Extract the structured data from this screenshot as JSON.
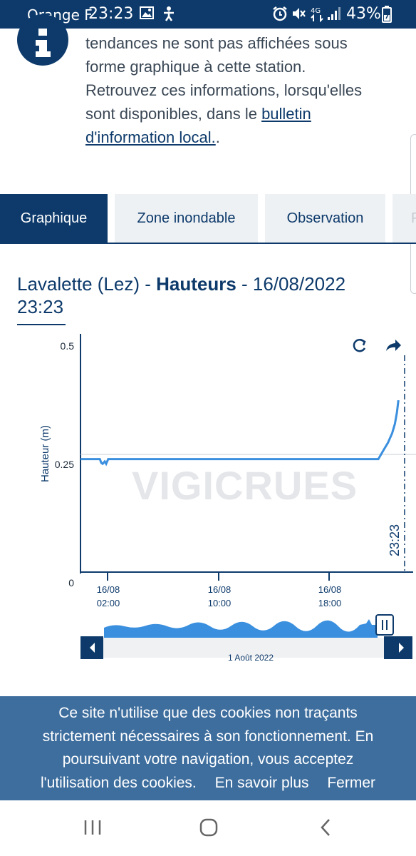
{
  "status_bar": {
    "carrier": "Orange F",
    "time": "23:23",
    "network": "4G",
    "battery": "43%",
    "icons": [
      "image-icon",
      "accessibility-icon",
      "alarm-icon",
      "mute-icon",
      "data-arrows-icon",
      "signal-icon",
      "battery-icon"
    ]
  },
  "info": {
    "icon": "info-icon",
    "lines": [
      "tendances ne sont pas affichées sous",
      "forme graphique à cette station.",
      "Retrouvez ces informations, lorsqu'elles",
      "sont disponibles, dans le"
    ],
    "link_part1": "bulletin",
    "link_part2": "d'information local.",
    "trailing": "."
  },
  "tabs": [
    {
      "label": "Graphique",
      "active": true
    },
    {
      "label": "Zone inondable",
      "active": false
    },
    {
      "label": "Observation",
      "active": false
    },
    {
      "label": "P",
      "active": false
    }
  ],
  "chart_title": {
    "station": "Lavalette (Lez) - ",
    "measure": "Hauteurs",
    "datetime_line1": " - 16/08/2022",
    "datetime_line2": "23:23"
  },
  "chart_data": {
    "type": "line",
    "ylabel": "Hauteur (m)",
    "y_ticks": [
      "0.5",
      "0.25",
      "0"
    ],
    "ylim": [
      0,
      0.5
    ],
    "x_ticks": [
      {
        "date": "16/08",
        "time": "02:00"
      },
      {
        "date": "16/08",
        "time": "10:00"
      },
      {
        "date": "16/08",
        "time": "18:00"
      }
    ],
    "x_range_hours": [
      0,
      23.4
    ],
    "now_marker": "23:23",
    "watermark": "VIGICRUES",
    "series": [
      {
        "color": "#3a8fde",
        "x_hours": [
          0,
          1.4,
          1.5,
          1.6,
          1.75,
          1.85,
          2.0,
          2.2,
          10,
          18,
          21.5,
          21.9,
          22.2,
          22.5,
          22.7,
          22.85,
          22.95
        ],
        "values": [
          0.24,
          0.24,
          0.232,
          0.23,
          0.235,
          0.23,
          0.24,
          0.24,
          0.24,
          0.24,
          0.24,
          0.26,
          0.275,
          0.295,
          0.315,
          0.34,
          0.365
        ]
      }
    ],
    "toolbar": {
      "refresh": "refresh-icon",
      "share": "share-icon"
    },
    "navigator": {
      "label": "1 Août 2022"
    }
  },
  "cookie_banner": {
    "lines": [
      "Ce site n'utilise que des cookies non traçants",
      "strictement nécessaires à son fonctionnement. En",
      "poursuivant votre navigation, vous acceptez",
      "l'utilisation des cookies."
    ],
    "learn_more": "En savoir plus",
    "close": "Fermer"
  },
  "nav_bar": [
    "recent-apps-icon",
    "home-icon",
    "back-icon"
  ],
  "colors": {
    "primary": "#0d3a6b",
    "accent": "#3a8fde",
    "cookie_bg": "#3e6e9e"
  }
}
